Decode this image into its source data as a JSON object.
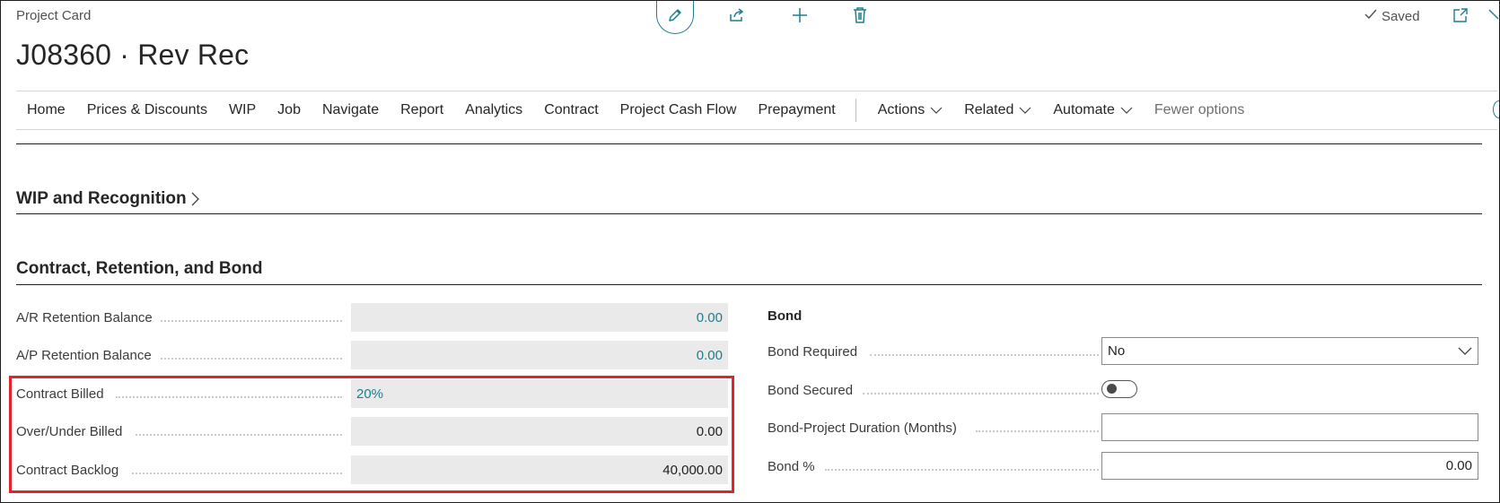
{
  "header": {
    "breadcrumb": "Project Card",
    "title": "J08360 · Rev Rec",
    "saved_label": "Saved"
  },
  "toolbar": {
    "icons": [
      "edit-icon",
      "share-icon",
      "add-icon",
      "delete-icon",
      "checkmark-icon",
      "open-new-window-icon",
      "collapse-icon"
    ]
  },
  "nav": {
    "items": [
      "Home",
      "Prices & Discounts",
      "WIP",
      "Job",
      "Navigate",
      "Report",
      "Analytics",
      "Contract",
      "Project Cash Flow",
      "Prepayment"
    ],
    "menus": [
      "Actions",
      "Related",
      "Automate"
    ],
    "fewer_options": "Fewer options"
  },
  "sections": {
    "wip_title": "WIP and Recognition",
    "contract_title": "Contract, Retention, and Bond"
  },
  "contract": {
    "ar_retention_label": "A/R Retention Balance",
    "ar_retention_value": "0.00",
    "ap_retention_label": "A/P Retention Balance",
    "ap_retention_value": "0.00",
    "contract_billed_label": "Contract Billed",
    "contract_billed_value": "20%",
    "over_under_label": "Over/Under Billed",
    "over_under_value": "0.00",
    "backlog_label": "Contract Backlog",
    "backlog_value": "40,000.00"
  },
  "bond": {
    "heading": "Bond",
    "required_label": "Bond Required",
    "required_value": "No",
    "secured_label": "Bond Secured",
    "secured_value": false,
    "duration_label": "Bond-Project Duration (Months)",
    "duration_value": "",
    "percent_label": "Bond %",
    "percent_value": "0.00"
  },
  "colors": {
    "accent": "#1f7d8c",
    "highlight": "#e2232a",
    "readonly_bg": "#eaeaea"
  }
}
